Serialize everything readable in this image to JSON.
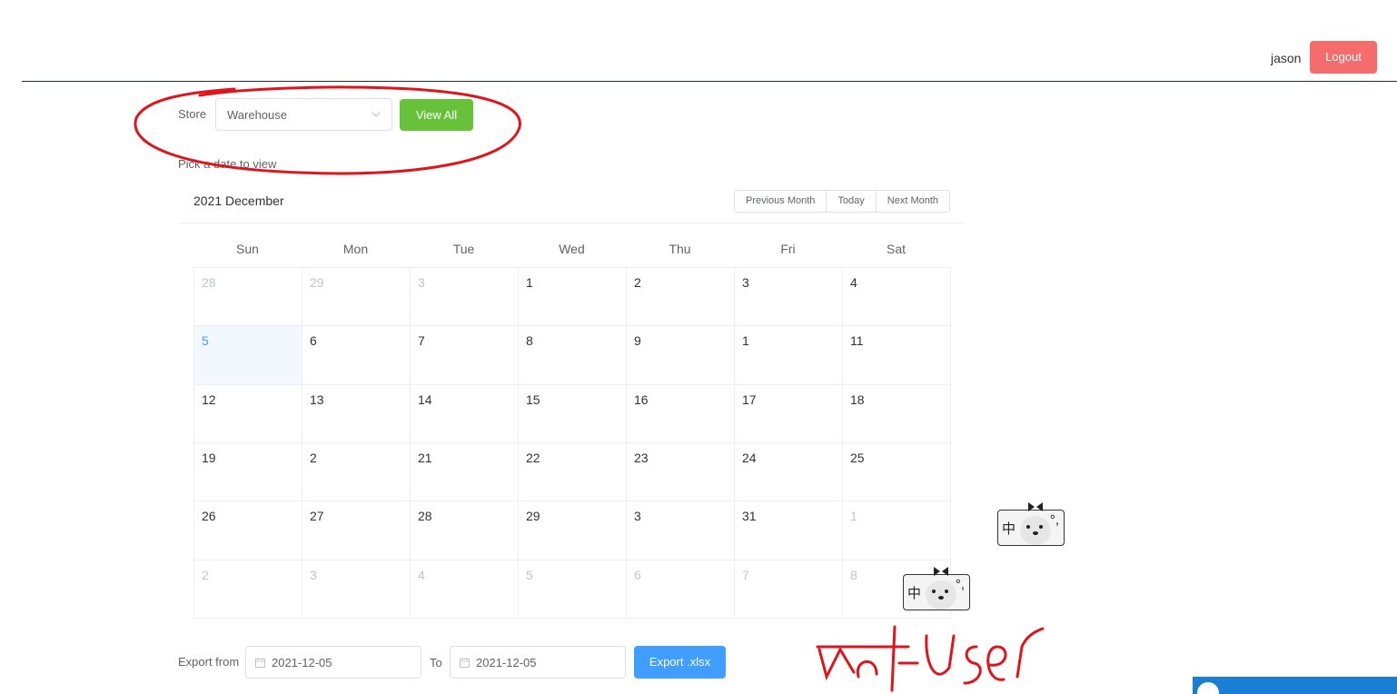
{
  "header": {
    "username": "jason",
    "logout_label": "Logout"
  },
  "store": {
    "label": "Store",
    "selected": "Warehouse",
    "view_all_label": "View All",
    "hint": "Pick a date to view"
  },
  "calendar": {
    "title": "2021 December",
    "buttons": [
      "Previous Month",
      "Today",
      "Next Month"
    ],
    "weekdays": [
      "Sun",
      "Mon",
      "Tue",
      "Wed",
      "Thu",
      "Fri",
      "Sat"
    ],
    "weeks": [
      [
        "28",
        "29",
        "3",
        "1",
        "2",
        "3",
        "4"
      ],
      [
        "5",
        "6",
        "7",
        "8",
        "9",
        "1",
        "11"
      ],
      [
        "12",
        "13",
        "14",
        "15",
        "16",
        "17",
        "18"
      ],
      [
        "19",
        "2",
        "21",
        "22",
        "23",
        "24",
        "25"
      ],
      [
        "26",
        "27",
        "28",
        "29",
        "3",
        "31",
        "1"
      ],
      [
        "2",
        "3",
        "4",
        "5",
        "6",
        "7",
        "8"
      ]
    ]
  },
  "export": {
    "from_label": "Export from",
    "from_value": "2021-12-05",
    "to_label": "To",
    "to_value": "2021-12-05",
    "button_label": "Export .xlsx"
  },
  "overlay": {
    "ime_char": "中",
    "ime_punct": "°,",
    "handwriting": "Add user",
    "annotation_color": "#e0151b"
  },
  "colors": {
    "danger": "#f56c6c",
    "success": "#67c23a",
    "primary": "#409eff"
  }
}
